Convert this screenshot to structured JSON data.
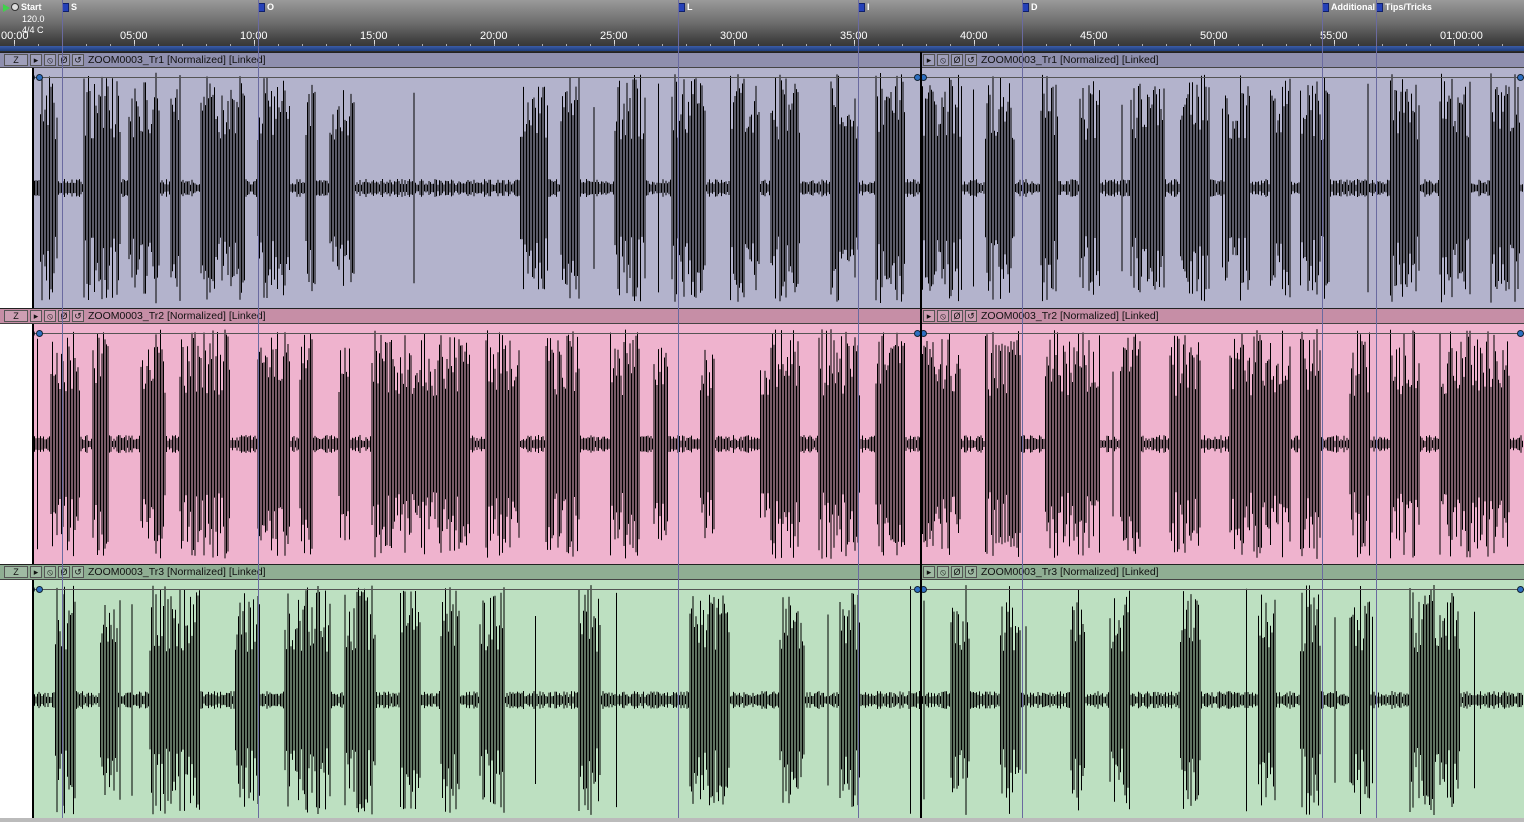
{
  "timeline": {
    "start_label": "Start",
    "tempo": "120.0 4/4 C",
    "markers": [
      {
        "label": "S",
        "time": "02:00"
      },
      {
        "label": "O",
        "time": "10:10"
      },
      {
        "label": "L",
        "time": "27:40"
      },
      {
        "label": "I",
        "time": "35:10"
      },
      {
        "label": "D",
        "time": "42:00"
      },
      {
        "label": "Additional",
        "time": "54:30"
      },
      {
        "label": "Tips/Tricks",
        "time": "56:45"
      }
    ],
    "ticks": [
      "00:00",
      "05:00",
      "10:00",
      "15:00",
      "20:00",
      "25:00",
      "30:00",
      "35:00",
      "40:00",
      "45:00",
      "50:00",
      "55:00",
      "01:00:00"
    ]
  },
  "tracks": [
    {
      "id": "tr1",
      "collapse_label": "Z",
      "clip_names": [
        "ZOOM0003_Tr1 [Normalized] [Linked]",
        "ZOOM0003_Tr1 [Normalized] [Linked]"
      ],
      "header_color": "#8f8fae",
      "body_color": "#b3b3cc"
    },
    {
      "id": "tr2",
      "collapse_label": "Z",
      "clip_names": [
        "ZOOM0003_Tr2 [Normalized] [Linked]",
        "ZOOM0003_Tr2 [Normalized] [Linked]"
      ],
      "header_color": "#c68ea6",
      "body_color": "#efb3ce"
    },
    {
      "id": "tr3",
      "collapse_label": "Z",
      "clip_names": [
        "ZOOM0003_Tr3 [Normalized] [Linked]",
        "ZOOM0003_Tr3 [Normalized] [Linked]"
      ],
      "header_color": "#8fae93",
      "body_color": "#bde0c1"
    }
  ],
  "icons": {
    "expand": "play-right-icon",
    "mute": "no-entry-icon",
    "phase": "phase-icon",
    "loop": "loop-icon"
  }
}
